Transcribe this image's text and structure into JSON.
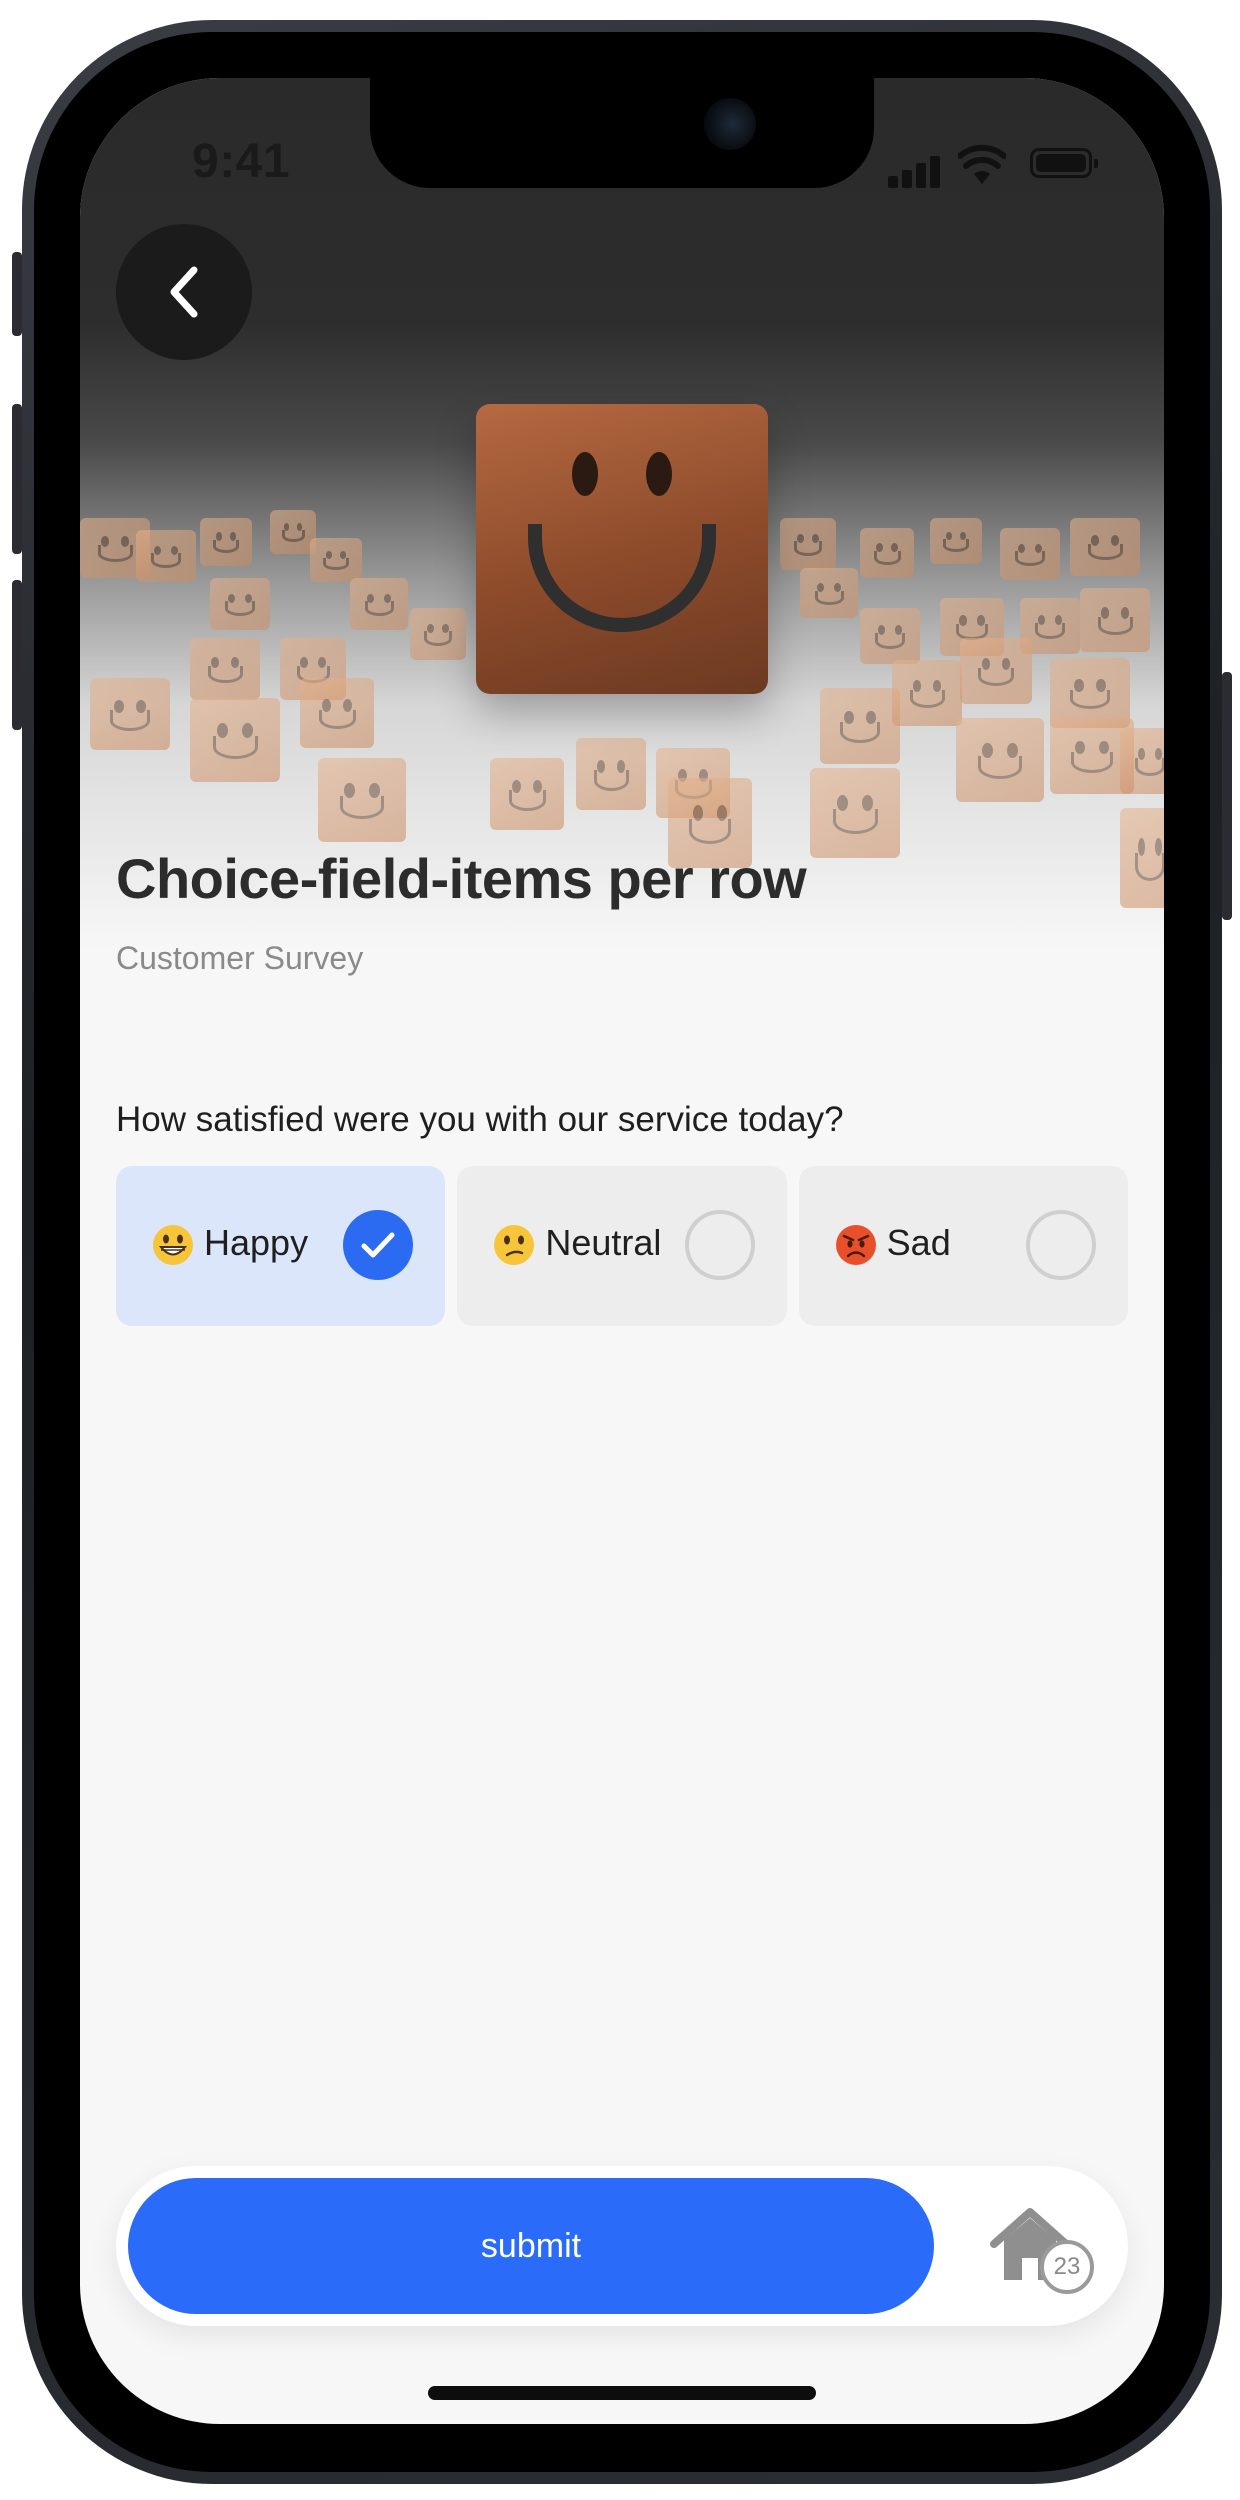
{
  "status_bar": {
    "time": "9:41"
  },
  "nav": {
    "back_icon": "chevron-left-icon"
  },
  "header": {
    "title": "Choice-field-items per row",
    "subtitle": "Customer Survey"
  },
  "form": {
    "question": "How satisfied were you with our service today?",
    "choices": [
      {
        "label": "Happy",
        "emoji": "grinning-face-icon",
        "selected": true
      },
      {
        "label": "Neutral",
        "emoji": "confused-face-icon",
        "selected": false
      },
      {
        "label": "Sad",
        "emoji": "angry-face-icon",
        "selected": false
      }
    ]
  },
  "footer": {
    "submit_label": "submit",
    "home_icon": "home-icon",
    "badge_count": "23"
  },
  "colors": {
    "accent": "#2a6bfa",
    "selected_bg": "#dce6fb",
    "choice_bg": "#ededed",
    "page_bg": "#f7f7f7"
  }
}
